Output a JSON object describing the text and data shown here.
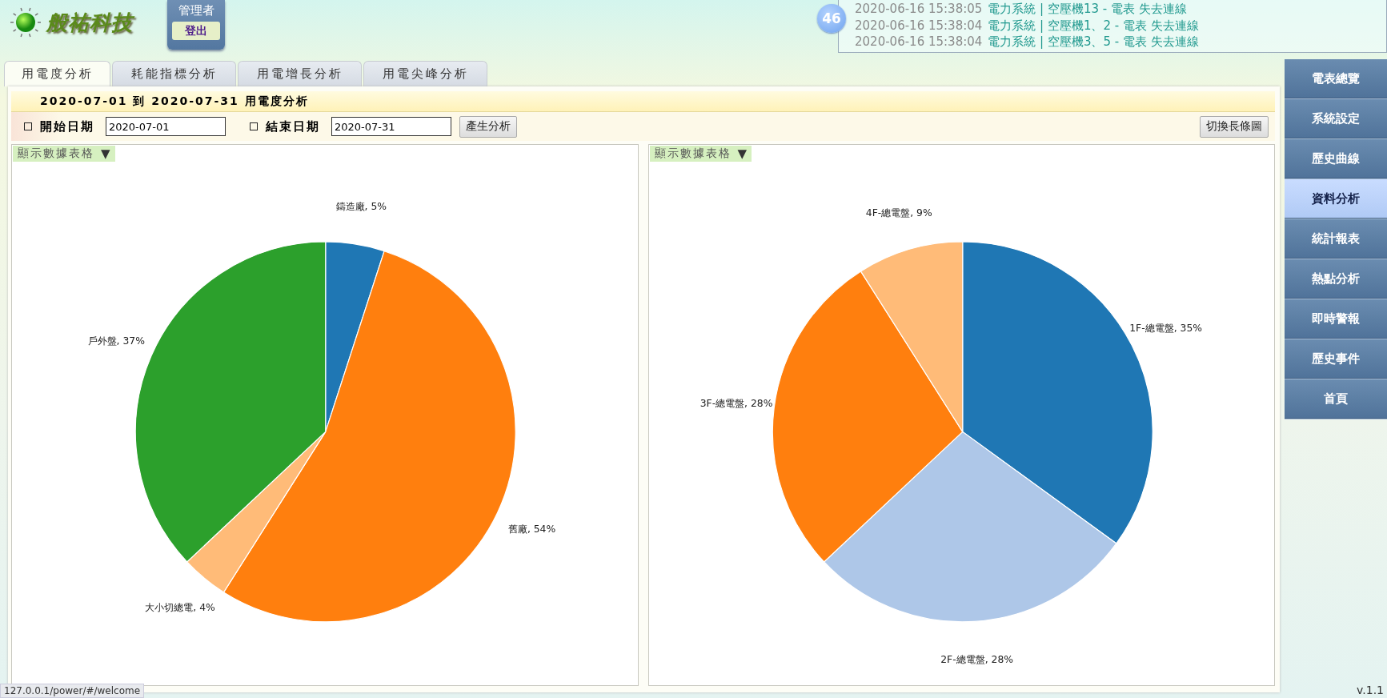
{
  "header": {
    "logo_text": "般祐科技",
    "user": {
      "role": "管理者",
      "logout": "登出"
    },
    "alert_count": "46",
    "notifications": [
      {
        "time": "2020-06-16 15:38:05",
        "text": "電力系統 | 空壓機13 - 電表 失去連線"
      },
      {
        "time": "2020-06-16 15:38:04",
        "text": "電力系統 | 空壓機1、2 - 電表 失去連線"
      },
      {
        "time": "2020-06-16 15:38:04",
        "text": "電力系統 | 空壓機3、5 - 電表 失去連線"
      }
    ]
  },
  "tabs": [
    {
      "label": "用電度分析",
      "selected": true
    },
    {
      "label": "耗能指標分析",
      "selected": false
    },
    {
      "label": "用電增長分析",
      "selected": false
    },
    {
      "label": "用電尖峰分析",
      "selected": false
    }
  ],
  "title": "2020-07-01 到 2020-07-31 用電度分析",
  "filters": {
    "start_label": "開始日期",
    "start_value": "2020-07-01",
    "end_label": "結束日期",
    "end_value": "2020-07-31",
    "generate": "產生分析",
    "switch": "切換長條圖"
  },
  "panels": [
    {
      "toggle": "顯示數據表格",
      "arrow": "▼",
      "chart_data": {
        "type": "pie",
        "categories": [
          "鑄造廠",
          "舊廠",
          "大小切總電",
          "戶外盤"
        ],
        "values": [
          5,
          54,
          4,
          37
        ],
        "colors": [
          "#1f77b4",
          "#ff7f0e",
          "#ffbb78",
          "#2ca02c"
        ],
        "value_labels": [
          ", 5%",
          ", 54%",
          ", 4%",
          ", 37%"
        ]
      }
    },
    {
      "toggle": "顯示數據表格",
      "arrow": "▼",
      "chart_data": {
        "type": "pie",
        "categories": [
          "1F-總電盤",
          "2F-總電盤",
          "3F-總電盤",
          "4F-總電盤"
        ],
        "values": [
          35,
          28,
          28,
          9
        ],
        "colors": [
          "#1f77b4",
          "#aec7e8",
          "#ff7f0e",
          "#ffbb78"
        ],
        "value_labels": [
          ", 35%",
          ", 28%",
          ", 28%",
          ", 9%"
        ]
      }
    }
  ],
  "sidebar": {
    "items": [
      {
        "label": "電表總覽",
        "selected": false
      },
      {
        "label": "系統設定",
        "selected": false
      },
      {
        "label": "歷史曲線",
        "selected": false
      },
      {
        "label": "資料分析",
        "selected": true
      },
      {
        "label": "統計報表",
        "selected": false
      },
      {
        "label": "熱點分析",
        "selected": false
      },
      {
        "label": "即時警報",
        "selected": false
      },
      {
        "label": "歷史事件",
        "selected": false
      },
      {
        "label": "首頁",
        "selected": false
      }
    ]
  },
  "status_url": "127.0.0.1/power/#/welcome",
  "version": "v.1.1"
}
